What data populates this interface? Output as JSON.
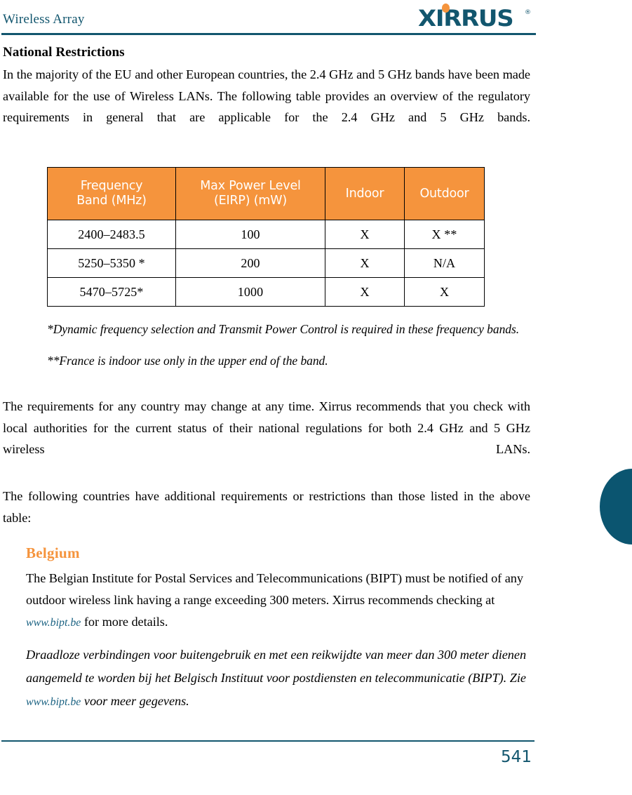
{
  "header": {
    "title": "Wireless Array",
    "logo_text": "XIRRUS",
    "logo_trademark": "®",
    "brand_teal": "#12566e",
    "brand_orange": "#f5943d"
  },
  "main": {
    "section_title": "National Restrictions",
    "intro_paragraph": "In the majority of the EU and other European countries, the 2.4 GHz and 5 GHz bands have been made available for the use of Wireless LANs. The following table provides an overview of the regulatory requirements in general that are applicable for the 2.4 GHz and 5 GHz bands."
  },
  "table": {
    "header_bg": "#f5943d",
    "header_text_color": "#ffffff",
    "columns": [
      "Frequency Band (MHz)",
      "Max Power Level (EIRP) (mW)",
      "Indoor",
      "Outdoor"
    ],
    "columns_lines": [
      [
        "Frequency",
        "Band (MHz)"
      ],
      [
        "Max Power Level",
        "(EIRP) (mW)"
      ],
      [
        "Indoor"
      ],
      [
        "Outdoor"
      ]
    ],
    "rows": [
      [
        "2400–2483.5",
        "100",
        "X",
        "X **"
      ],
      [
        "5250–5350 *",
        "200",
        "X",
        "N/A"
      ],
      [
        "5470–5725*",
        "1000",
        "X",
        "X"
      ]
    ]
  },
  "footnotes": [
    "*Dynamic frequency selection and Transmit Power Control is required in these frequency bands.",
    "**France is indoor use only in the upper end of the band."
  ],
  "lower_paragraphs": [
    "The requirements for any country may change at any time. Xirrus recommends that you check with local authorities for the current status of their national regulations for both 2.4 GHz and 5 GHz wireless LANs.",
    "The following countries have additional requirements or restrictions than those listed in the above table:"
  ],
  "country": {
    "title": "Belgium",
    "title_color": "#f5943d",
    "english_part1": "The Belgian Institute for Postal Services and Telecommunications (BIPT) must be notified of any outdoor wireless link having a range exceeding 300 meters. Xirrus recommends checking at ",
    "english_link": "www.bipt.be",
    "english_part2": " for more details.",
    "dutch_part1": "Draadloze verbindingen voor buitengebruik en met een reikwijdte van meer dan 300 meter dienen aangemeld te worden bij het Belgisch Instituut voor postdiensten en telecommunicatie (BIPT). Zie ",
    "dutch_link": "www.bipt.be",
    "dutch_part2": " voor meer gegevens.",
    "link_color": "#1c6383"
  },
  "footer": {
    "page_number": "541",
    "rule_color": "#12566e"
  },
  "thumb_tab": {
    "color": "#0b5570"
  }
}
